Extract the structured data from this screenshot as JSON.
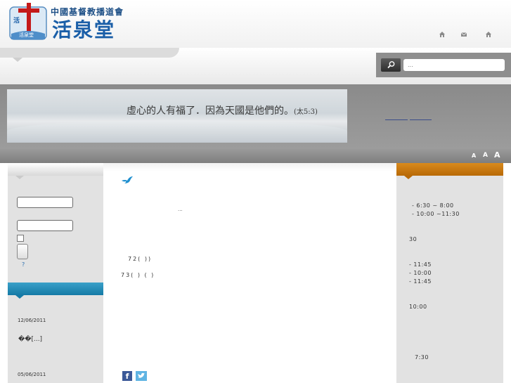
{
  "header": {
    "org_name": "中國基督教播道會",
    "church_name": "活泉堂",
    "logo_mark": "活泉堂"
  },
  "search": {
    "placeholder": "..."
  },
  "banner": {
    "verse": "虛心的人有福了．因為天國是他們的。",
    "reference": "(太5:3)"
  },
  "font_size": {
    "small": "A",
    "medium": "A",
    "large": "A"
  },
  "left": {
    "help_mark": "?",
    "posts": [
      {
        "date": "12/06/2011",
        "text": "��[...]"
      },
      {
        "date": "05/06/2011"
      }
    ]
  },
  "main": {
    "ellipsis": "...",
    "line1": "72( ))",
    "line2": "73( ) ( )",
    "facebook_label": "f"
  },
  "right": {
    "times1": [
      "- 6:30 ~ 8:00",
      "- 10:00 ~11:30"
    ],
    "num30": "30",
    "times2": [
      "- 11:45",
      "- 10:00",
      "- 11:45"
    ],
    "time3": "10:00",
    "time4": "7:30"
  },
  "colors": {
    "brand_blue": "#1b5fa8",
    "left_accent": "#157aa6",
    "right_accent": "#b86906"
  }
}
